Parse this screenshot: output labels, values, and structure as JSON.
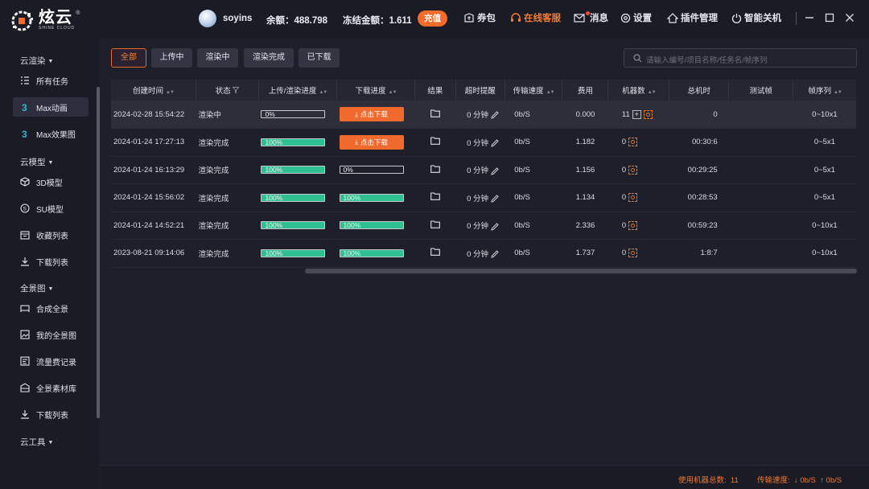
{
  "app": {
    "logo_cn": "炫云",
    "logo_en": "SHINE CLOUD",
    "logo_reg": "®"
  },
  "header": {
    "username": "soyins",
    "balance_label": "余额：",
    "balance_value": "488.798",
    "frozen_label": "冻结金额：",
    "frozen_value": "1.611",
    "recharge": "充值",
    "items": [
      {
        "label": "券包",
        "icon": "coupon-icon"
      },
      {
        "label": "在线客服",
        "icon": "headset-icon"
      },
      {
        "label": "消息",
        "icon": "mail-icon"
      },
      {
        "label": "设置",
        "icon": "gear-icon"
      },
      {
        "label": "插件管理",
        "icon": "plugin-icon"
      },
      {
        "label": "智能关机",
        "icon": "power-icon"
      }
    ]
  },
  "sidebar": {
    "sections": [
      {
        "title": "云渲染",
        "items": [
          {
            "label": "所有任务",
            "icon": "task-list-icon"
          },
          {
            "label": "Max动画",
            "icon": "max-icon"
          },
          {
            "label": "Max效果图",
            "icon": "max-icon"
          }
        ]
      },
      {
        "title": "云模型",
        "items": [
          {
            "label": "3D模型",
            "icon": "cube-icon"
          },
          {
            "label": "SU模型",
            "icon": "su-icon"
          },
          {
            "label": "收藏列表",
            "icon": "favorites-icon"
          },
          {
            "label": "下载列表",
            "icon": "download-icon"
          }
        ]
      },
      {
        "title": "全景图",
        "items": [
          {
            "label": "合成全景",
            "icon": "panorama-icon"
          },
          {
            "label": "我的全景图",
            "icon": "image-icon"
          },
          {
            "label": "流量费记录",
            "icon": "record-icon"
          },
          {
            "label": "全景素材库",
            "icon": "library-icon"
          },
          {
            "label": "下载列表",
            "icon": "download-icon"
          }
        ]
      },
      {
        "title": "云工具",
        "items": []
      }
    ],
    "active": "Max动画"
  },
  "filters": [
    "全部",
    "上传中",
    "渲染中",
    "渲染完成",
    "已下载"
  ],
  "search": {
    "placeholder": "请输入编号/项目名称/任务名/帧序列"
  },
  "table": {
    "headers": [
      "创建时间",
      "状态",
      "上传/渲染进度",
      "下载进度",
      "结果",
      "超时提醒",
      "传输速度",
      "费用",
      "机器数",
      "总机时",
      "测试帧",
      "帧序列"
    ],
    "download_btn": "点击下载",
    "rows": [
      {
        "time": "2024-02-28 15:54:22",
        "status": "渲染中",
        "upload": "0%",
        "upload_pct": 0,
        "download": "button",
        "timeout": "0 分钟",
        "speed": "0b/S",
        "cost": "0.000",
        "machines": "11",
        "total": "0",
        "test": "",
        "frames": "0~10x1"
      },
      {
        "time": "2024-01-24 17:27:13",
        "status": "渲染完成",
        "upload": "100%",
        "upload_pct": 100,
        "download": "button",
        "timeout": "0 分钟",
        "speed": "0b/S",
        "cost": "1.182",
        "machines": "0",
        "total": "00:30:6",
        "test": "",
        "frames": "0~5x1"
      },
      {
        "time": "2024-01-24 16:13:29",
        "status": "渲染完成",
        "upload": "100%",
        "upload_pct": 100,
        "download": "0%",
        "download_pct": 0,
        "timeout": "0 分钟",
        "speed": "0b/S",
        "cost": "1.156",
        "machines": "0",
        "total": "00:29:25",
        "test": "",
        "frames": "0~5x1"
      },
      {
        "time": "2024-01-24 15:56:02",
        "status": "渲染完成",
        "upload": "100%",
        "upload_pct": 100,
        "download": "100%",
        "download_pct": 100,
        "timeout": "0 分钟",
        "speed": "0b/S",
        "cost": "1.134",
        "machines": "0",
        "total": "00:28:53",
        "test": "",
        "frames": "0~5x1"
      },
      {
        "time": "2024-01-24 14:52:21",
        "status": "渲染完成",
        "upload": "100%",
        "upload_pct": 100,
        "download": "100%",
        "download_pct": 100,
        "timeout": "0 分钟",
        "speed": "0b/S",
        "cost": "2.336",
        "machines": "0",
        "total": "00:59:23",
        "test": "",
        "frames": "0~10x1"
      },
      {
        "time": "2023-08-21 09:14:06",
        "status": "渲染完成",
        "upload": "100%",
        "upload_pct": 100,
        "download": "100%",
        "download_pct": 100,
        "timeout": "0 分钟",
        "speed": "0b/S",
        "cost": "1.737",
        "machines": "0",
        "total": "1:8:7",
        "test": "",
        "frames": "0~10x1"
      }
    ]
  },
  "statusbar": {
    "machines_label": "使用机器总数:",
    "machines_value": "11",
    "speed_label": "传输速度:",
    "down": "0b/S",
    "up": "0b/S"
  },
  "colors": {
    "accent": "#f26b2a",
    "progress": "#2ec090",
    "bg": "#1e1e2a"
  }
}
